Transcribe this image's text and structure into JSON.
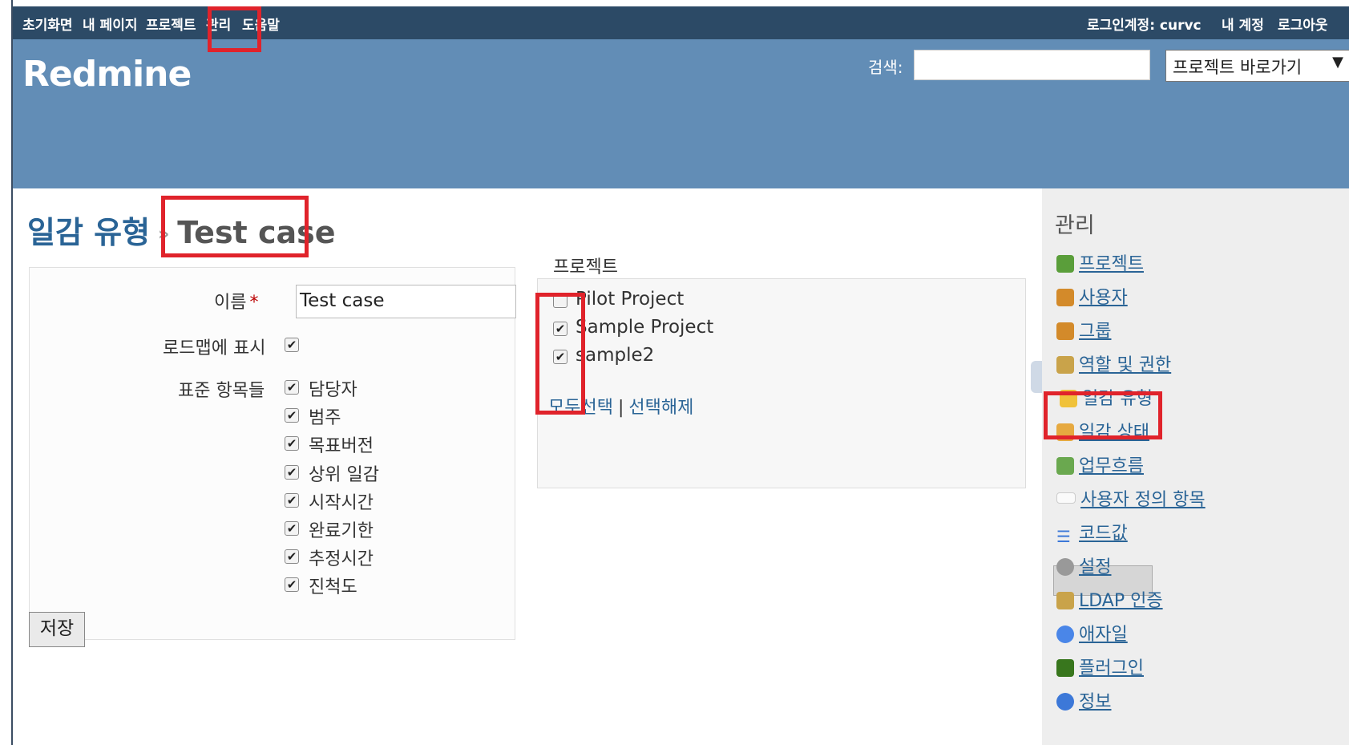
{
  "top_menu": {
    "home": "초기화면",
    "my_page": "내 페이지",
    "projects": "프로젝트",
    "admin": "관리",
    "help": "도움말",
    "logged_in_as": "로그인계정: curvc",
    "my_account": "내 계정",
    "logout": "로그아웃"
  },
  "header": {
    "logo": "Redmine",
    "search_label": "검색:",
    "search_value": "",
    "project_jump": "프로젝트 바로가기",
    "project_jump_arrow": "▼"
  },
  "page": {
    "breadcrumb_parent": "일감 유형",
    "breadcrumb_sep": "»",
    "title": "Test case"
  },
  "form": {
    "name_label": "이름",
    "required_mark": "*",
    "name_value": "Test case",
    "roadmap_label": "로드맵에 표시",
    "roadmap_checked": true,
    "core_fields_label": "표준 항목들",
    "core_fields": [
      {
        "label": "담당자",
        "checked": true
      },
      {
        "label": "범주",
        "checked": true
      },
      {
        "label": "목표버전",
        "checked": true
      },
      {
        "label": "상위 일감",
        "checked": true
      },
      {
        "label": "시작시간",
        "checked": true
      },
      {
        "label": "완료기한",
        "checked": true
      },
      {
        "label": "추정시간",
        "checked": true
      },
      {
        "label": "진척도",
        "checked": true
      }
    ],
    "save_button": "저장"
  },
  "projects_box": {
    "legend": "프로젝트",
    "items": [
      {
        "label": "Pilot Project",
        "checked": false
      },
      {
        "label": "Sample Project",
        "checked": true
      },
      {
        "label": "sample2",
        "checked": true
      }
    ],
    "check_all": "모두선택",
    "separator": "|",
    "uncheck_all": "선택해제"
  },
  "sidebar": {
    "title": "관리",
    "items": [
      {
        "label": "프로젝트",
        "icon": "projects-icon",
        "color": "#5a9e3a"
      },
      {
        "label": "사용자",
        "icon": "user-icon",
        "color": "#d38a2a"
      },
      {
        "label": "그룹",
        "icon": "group-icon",
        "color": "#d38a2a"
      },
      {
        "label": "역할 및 권한",
        "icon": "roles-icon",
        "color": "#c9a34a"
      },
      {
        "label": "일감 유형",
        "icon": "tracker-icon",
        "color": "#f0c23a"
      },
      {
        "label": "일감 상태",
        "icon": "issue-status-icon",
        "color": "#e6a940"
      },
      {
        "label": "업무흐름",
        "icon": "workflow-icon",
        "color": "#6aa84f"
      },
      {
        "label": "사용자 정의 항목",
        "icon": "custom-fields-icon",
        "color": "#e8e8e8"
      },
      {
        "label": "코드값",
        "icon": "list-icon",
        "color": "#3c78d8"
      },
      {
        "label": "설정",
        "icon": "settings-icon",
        "color": "#999999"
      },
      {
        "label": "LDAP 인증",
        "icon": "ldap-icon",
        "color": "#c9a34a"
      },
      {
        "label": "애자일",
        "icon": "agile-icon",
        "color": "#4a86e8"
      },
      {
        "label": "플러그인",
        "icon": "plugin-icon",
        "color": "#38761d"
      },
      {
        "label": "정보",
        "icon": "info-icon",
        "color": "#3c78d8"
      }
    ]
  },
  "colors": {
    "top_menu_bg": "#2c4a66",
    "header_bg": "#628db6",
    "link": "#2a6496",
    "highlight": "#e0232b"
  }
}
